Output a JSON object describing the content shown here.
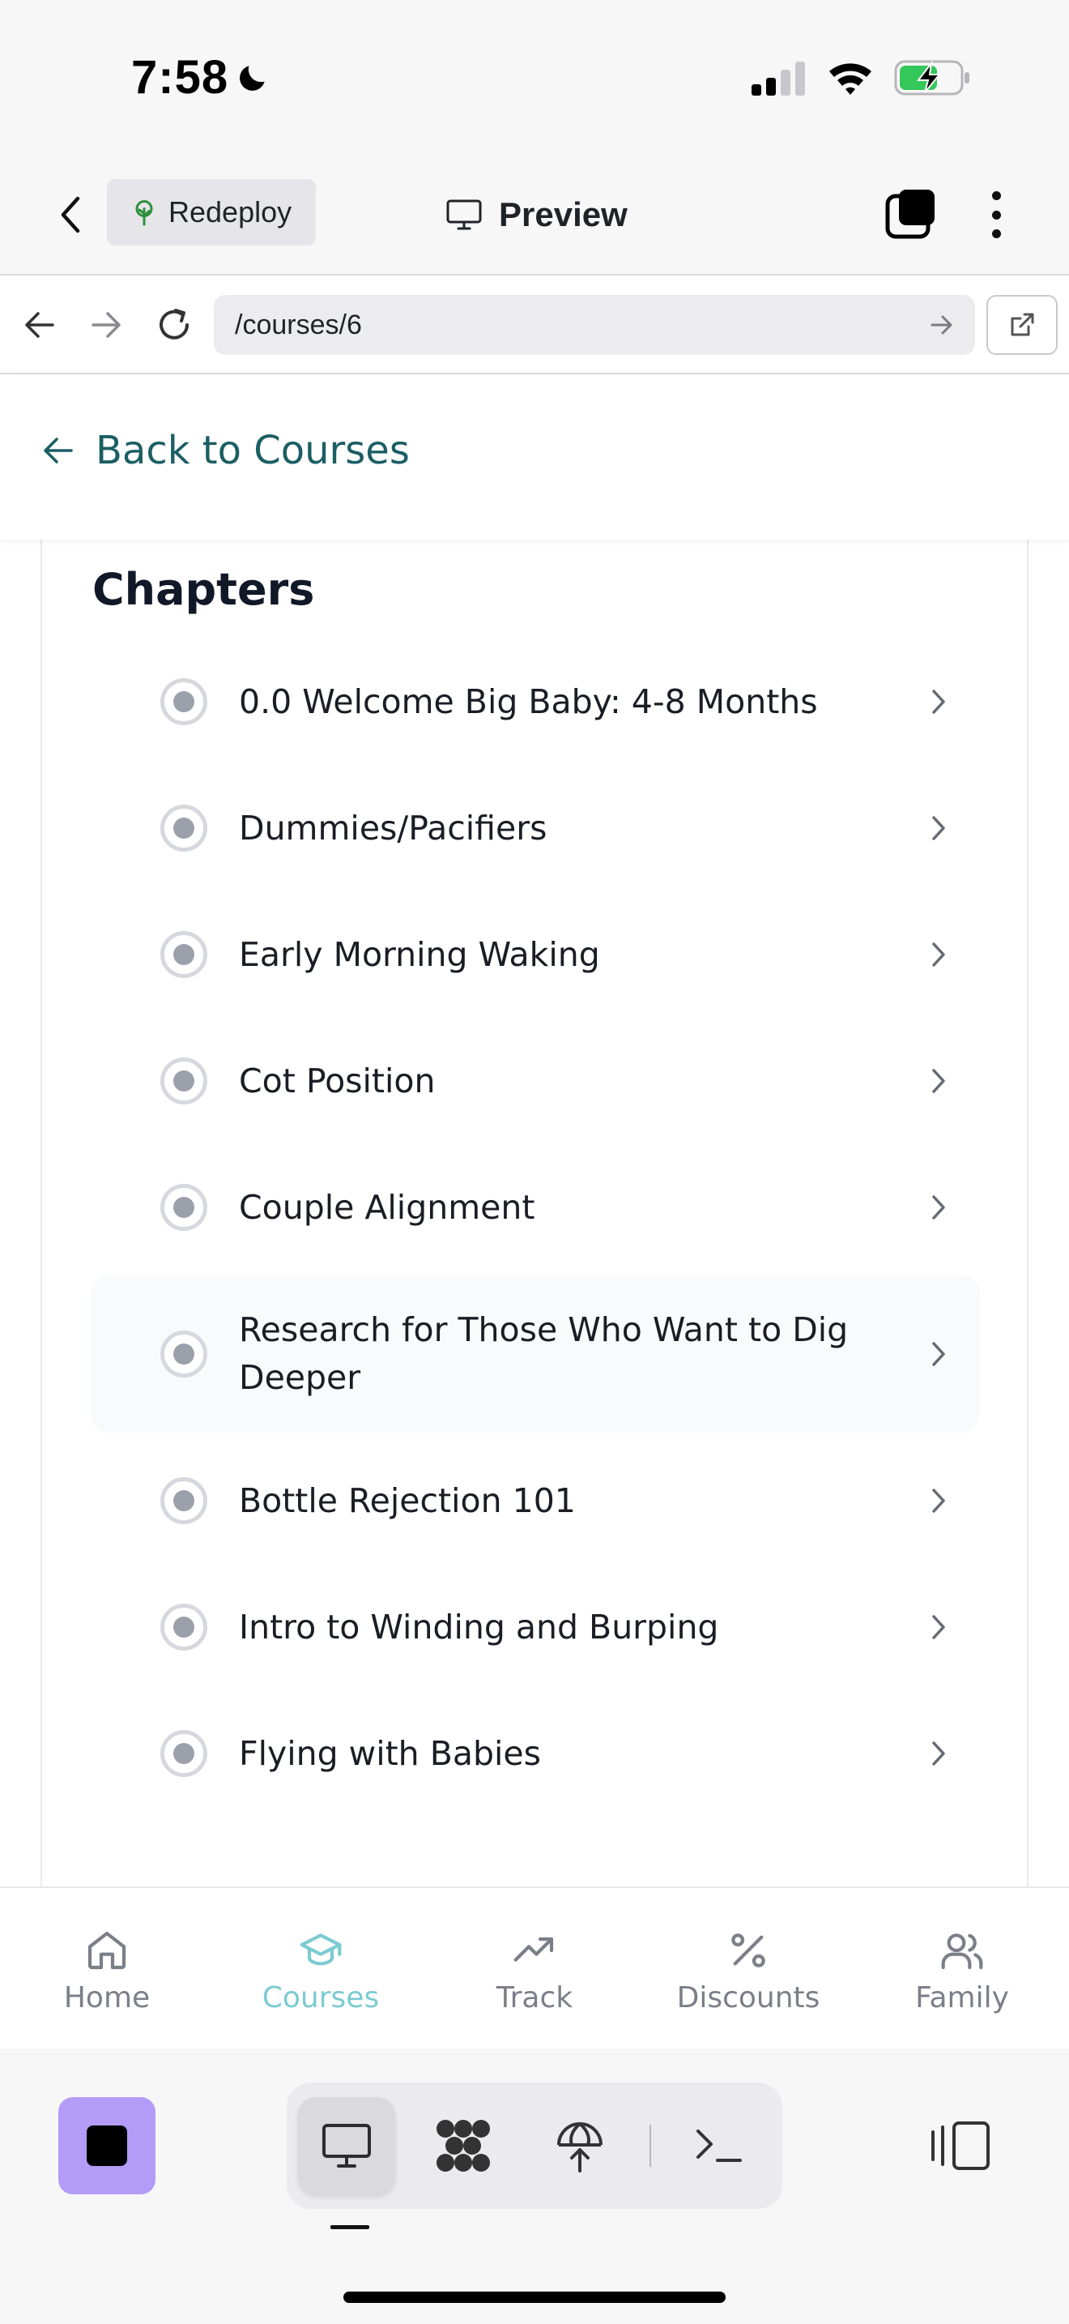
{
  "status": {
    "time": "7:58"
  },
  "topbar": {
    "redeploy_label": "Redeploy",
    "preview_label": "Preview"
  },
  "urlbar": {
    "url": "/courses/6"
  },
  "header": {
    "back_label": "Back to Courses"
  },
  "chapters": {
    "title": "Chapters",
    "items": [
      {
        "label": "0.0 Welcome Big Baby: 4-8 Months"
      },
      {
        "label": "Dummies/Pacifiers"
      },
      {
        "label": "Early Morning Waking"
      },
      {
        "label": "Cot Position"
      },
      {
        "label": "Couple Alignment"
      },
      {
        "label": "Research for Those Who Want to Dig Deeper"
      },
      {
        "label": "Bottle Rejection 101"
      },
      {
        "label": "Intro to Winding and Burping"
      },
      {
        "label": "Flying with Babies"
      }
    ]
  },
  "bottom_nav": {
    "items": [
      {
        "label": "Home",
        "icon": "home-icon"
      },
      {
        "label": "Courses",
        "icon": "graduation-cap-icon",
        "active": true
      },
      {
        "label": "Track",
        "icon": "trending-up-icon"
      },
      {
        "label": "Discounts",
        "icon": "percent-icon"
      },
      {
        "label": "Family",
        "icon": "users-icon"
      }
    ]
  },
  "colors": {
    "accent_teal": "#1b5e64",
    "active_tab": "#7ccbd1",
    "stop_button": "#b39cf7"
  }
}
